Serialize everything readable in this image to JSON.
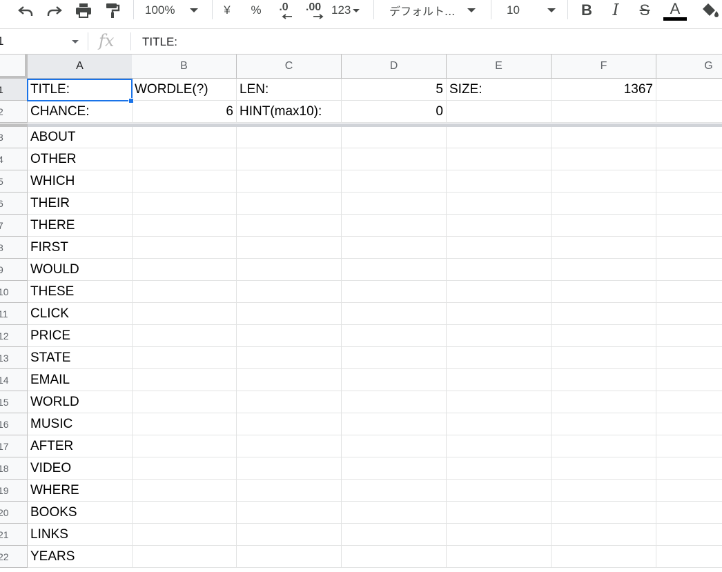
{
  "toolbar": {
    "zoom": "100%",
    "currency_label": "¥",
    "percent_label": "%",
    "decrease_decimal_label": ".0",
    "increase_decimal_label": ".00",
    "number_format_label": "123",
    "font_name": "デフォルト...",
    "font_size": "10",
    "bold_label": "B",
    "italic_label": "I",
    "strike_label": "S",
    "text_color_label": "A",
    "text_color": "#000000",
    "accent_color": "#1a73e8"
  },
  "formula_bar": {
    "name_box": "1",
    "fx_label": "fx",
    "content": "TITLE:"
  },
  "columns": [
    "A",
    "B",
    "C",
    "D",
    "E",
    "F",
    "G"
  ],
  "active_column": "A",
  "active_row": "1",
  "rows": [
    {
      "num": "1",
      "cells": [
        "TITLE:",
        "WORDLE(?)",
        "LEN:",
        "5",
        "SIZE:",
        "1367",
        ""
      ]
    },
    {
      "num": "2",
      "cells": [
        "CHANCE:",
        "6",
        "HINT(max10):",
        "0",
        "",
        "",
        ""
      ]
    },
    {
      "num": "3",
      "cells": [
        "ABOUT",
        "",
        "",
        "",
        "",
        "",
        ""
      ]
    },
    {
      "num": "4",
      "cells": [
        "OTHER",
        "",
        "",
        "",
        "",
        "",
        ""
      ]
    },
    {
      "num": "5",
      "cells": [
        "WHICH",
        "",
        "",
        "",
        "",
        "",
        ""
      ]
    },
    {
      "num": "6",
      "cells": [
        "THEIR",
        "",
        "",
        "",
        "",
        "",
        ""
      ]
    },
    {
      "num": "7",
      "cells": [
        "THERE",
        "",
        "",
        "",
        "",
        "",
        ""
      ]
    },
    {
      "num": "8",
      "cells": [
        "FIRST",
        "",
        "",
        "",
        "",
        "",
        ""
      ]
    },
    {
      "num": "9",
      "cells": [
        "WOULD",
        "",
        "",
        "",
        "",
        "",
        ""
      ]
    },
    {
      "num": "10",
      "cells": [
        "THESE",
        "",
        "",
        "",
        "",
        "",
        ""
      ]
    },
    {
      "num": "11",
      "cells": [
        "CLICK",
        "",
        "",
        "",
        "",
        "",
        ""
      ]
    },
    {
      "num": "12",
      "cells": [
        "PRICE",
        "",
        "",
        "",
        "",
        "",
        ""
      ]
    },
    {
      "num": "13",
      "cells": [
        "STATE",
        "",
        "",
        "",
        "",
        "",
        ""
      ]
    },
    {
      "num": "14",
      "cells": [
        "EMAIL",
        "",
        "",
        "",
        "",
        "",
        ""
      ]
    },
    {
      "num": "15",
      "cells": [
        "WORLD",
        "",
        "",
        "",
        "",
        "",
        ""
      ]
    },
    {
      "num": "16",
      "cells": [
        "MUSIC",
        "",
        "",
        "",
        "",
        "",
        ""
      ]
    },
    {
      "num": "17",
      "cells": [
        "AFTER",
        "",
        "",
        "",
        "",
        "",
        ""
      ]
    },
    {
      "num": "18",
      "cells": [
        "VIDEO",
        "",
        "",
        "",
        "",
        "",
        ""
      ]
    },
    {
      "num": "19",
      "cells": [
        "WHERE",
        "",
        "",
        "",
        "",
        "",
        ""
      ]
    },
    {
      "num": "20",
      "cells": [
        "BOOKS",
        "",
        "",
        "",
        "",
        "",
        ""
      ]
    },
    {
      "num": "21",
      "cells": [
        "LINKS",
        "",
        "",
        "",
        "",
        "",
        ""
      ]
    },
    {
      "num": "22",
      "cells": [
        "YEARS",
        "",
        "",
        "",
        "",
        "",
        ""
      ]
    }
  ]
}
